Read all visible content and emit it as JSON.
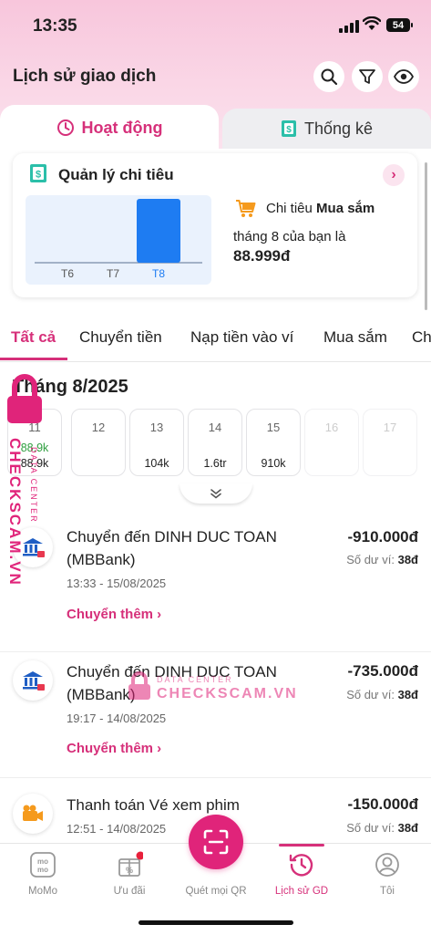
{
  "status": {
    "time": "13:35",
    "battery": "54"
  },
  "header": {
    "title": "Lịch sử giao dịch"
  },
  "tabs": {
    "active": "Hoạt động",
    "inactive": "Thống kê"
  },
  "spending_card": {
    "title": "Quản lý chi tiêu",
    "category_prefix": "Chi tiêu",
    "category": "Mua sắm",
    "line2": "tháng 8 của bạn là",
    "amount": "88.999đ",
    "chart_labels": [
      "T6",
      "T7",
      "T8"
    ],
    "chart_values": [
      0,
      0,
      88999
    ]
  },
  "filters": [
    "Tất cả",
    "Chuyển tiền",
    "Nạp tiền vào ví",
    "Mua sắm",
    "Ch"
  ],
  "month": {
    "title": "Tháng 8/2025"
  },
  "days": [
    {
      "day": "11",
      "income": "88.9k",
      "expense": "88.9k"
    },
    {
      "day": "12",
      "income": "",
      "expense": ""
    },
    {
      "day": "13",
      "income": "",
      "expense": "104k"
    },
    {
      "day": "14",
      "income": "",
      "expense": "1.6tr"
    },
    {
      "day": "15",
      "income": "",
      "expense": "910k"
    },
    {
      "day": "16",
      "income": "",
      "expense": ""
    },
    {
      "day": "17",
      "income": "",
      "expense": ""
    }
  ],
  "transactions": [
    {
      "title": "Chuyển đến DINH DUC TOAN (MBBank)",
      "amount": "-910.000đ",
      "balance_label": "Số dư ví:",
      "balance": "38đ",
      "time": "13:33 - 15/08/2025",
      "link": "Chuyển thêm"
    },
    {
      "title": "Chuyển đến DINH DUC TOAN (MBBank)",
      "amount": "-735.000đ",
      "balance_label": "Số dư ví:",
      "balance": "38đ",
      "time": "19:17 - 14/08/2025",
      "link": "Chuyển thêm"
    },
    {
      "title": "Thanh toán Vé xem phim",
      "amount": "-150.000đ",
      "balance_label": "Số dư ví:",
      "balance": "38đ",
      "time": "12:51 - 14/08/2025"
    }
  ],
  "watermark": {
    "brand": "CHECKSCAM.VN",
    "sub": "DATA CENTER"
  },
  "bottom_nav": [
    {
      "label": "MoMo"
    },
    {
      "label": "Ưu đãi"
    },
    {
      "label": "Quét mọi QR"
    },
    {
      "label": "Lịch sử GD"
    },
    {
      "label": "Tôi"
    }
  ],
  "colors": {
    "accent": "#d6307a",
    "pink_button": "#e0247a",
    "chart_bar": "#1e7cf2"
  }
}
